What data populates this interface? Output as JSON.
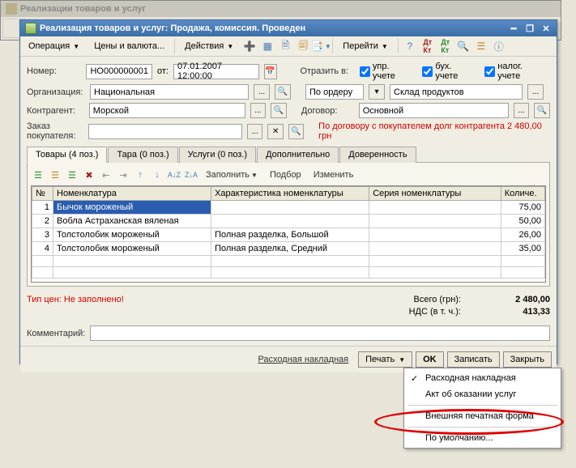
{
  "outer": {
    "title": "Реализации товаров и услуг"
  },
  "inner": {
    "title": "Реализация товаров и услуг: Продажа, комиссия. Проведен"
  },
  "toolbar": {
    "operation": "Операция",
    "prices": "Цены и валюта...",
    "actions": "Действия",
    "goto": "Перейти"
  },
  "form": {
    "number_label": "Номер:",
    "number": "НО000000001",
    "from_label": "от:",
    "date": "07.01.2007 12:00:00",
    "reflect_label": "Отразить в:",
    "upr_label": "упр. учете",
    "bux_label": "бух. учете",
    "nalog_label": "налог. учете",
    "org_label": "Организация:",
    "org": "Национальная",
    "order_label": "По ордеру",
    "stock": "Склад продуктов",
    "contr_label": "Контрагент:",
    "contr": "Морской",
    "dogovor_label": "Договор:",
    "dogovor": "Основной",
    "zakaz_label": "Заказ покупателя:",
    "warn": "По договору с покупателем долг контрагента 2 480,00 грн"
  },
  "tabs": {
    "goods": "Товары (4 поз.)",
    "tara": "Тара (0 поз.)",
    "services": "Услуги (0 поз.)",
    "extra": "Дополнительно",
    "dover": "Доверенность"
  },
  "grid_toolbar": {
    "fill": "Заполнить",
    "podbor": "Подбор",
    "change": "Изменить"
  },
  "grid": {
    "headers": {
      "n": "№",
      "nom": "Номенклатура",
      "char": "Характеристика номенклатуры",
      "ser": "Серия номенклатуры",
      "qty": "Количе."
    },
    "rows": [
      {
        "n": "1",
        "nom": "Бычок мороженый",
        "char": "",
        "ser": "",
        "qty": "75,00"
      },
      {
        "n": "2",
        "nom": "Вобла Астраханская вяленая",
        "char": "",
        "ser": "",
        "qty": "50,00"
      },
      {
        "n": "3",
        "nom": "Толстолобик мороженый",
        "char": "Полная разделка, Большой",
        "ser": "",
        "qty": "26,00"
      },
      {
        "n": "4",
        "nom": "Толстолобик мороженый",
        "char": "Полная разделка, Средний",
        "ser": "",
        "qty": "35,00"
      }
    ]
  },
  "totals": {
    "price_type_label": "Тип цен: Не заполнено!",
    "total_label": "Всего (грн):",
    "total": "2 480,00",
    "nds_label": "НДС (в т. ч.):",
    "nds": "413,33"
  },
  "comment_label": "Комментарий:",
  "bottom": {
    "rashod": "Расходная накладная",
    "print": "Печать",
    "ok": "OK",
    "save": "Записать",
    "close": "Закрыть"
  },
  "menu": {
    "item1": "Расходная накладная",
    "item2": "Акт об оказании услуг",
    "item3": "Внешняя печатная форма",
    "item4": "По умолчанию..."
  }
}
